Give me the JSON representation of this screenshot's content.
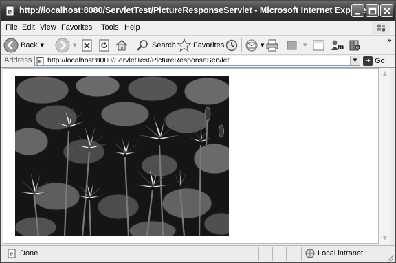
{
  "window": {
    "title": "http://localhost:8080/ServletTest/PictureResponseServlet - Microsoft Internet Explorer",
    "controls": [
      "minimize-icon",
      "maximize-icon",
      "close-icon"
    ]
  },
  "menu": {
    "items": [
      "File",
      "Edit",
      "View",
      "Favorites",
      "Tools",
      "Help"
    ]
  },
  "toolbar": {
    "back_label": "Back",
    "search_label": "Search",
    "favorites_label": "Favorites",
    "icons": [
      "back-icon",
      "forward-icon",
      "stop-icon",
      "refresh-icon",
      "home-icon",
      "search-icon",
      "favorites-star-icon",
      "history-icon",
      "mail-icon",
      "print-icon",
      "edit-icon",
      "discuss-icon",
      "messenger-icon",
      "research-icon"
    ]
  },
  "address": {
    "label": "Address",
    "url": "http://localhost:8080/ServletTest/PictureResponseServlet",
    "go_label": "Go"
  },
  "content": {
    "image": "water-lilies-photo"
  },
  "status": {
    "text": "Done",
    "zone": "Local intranet"
  }
}
